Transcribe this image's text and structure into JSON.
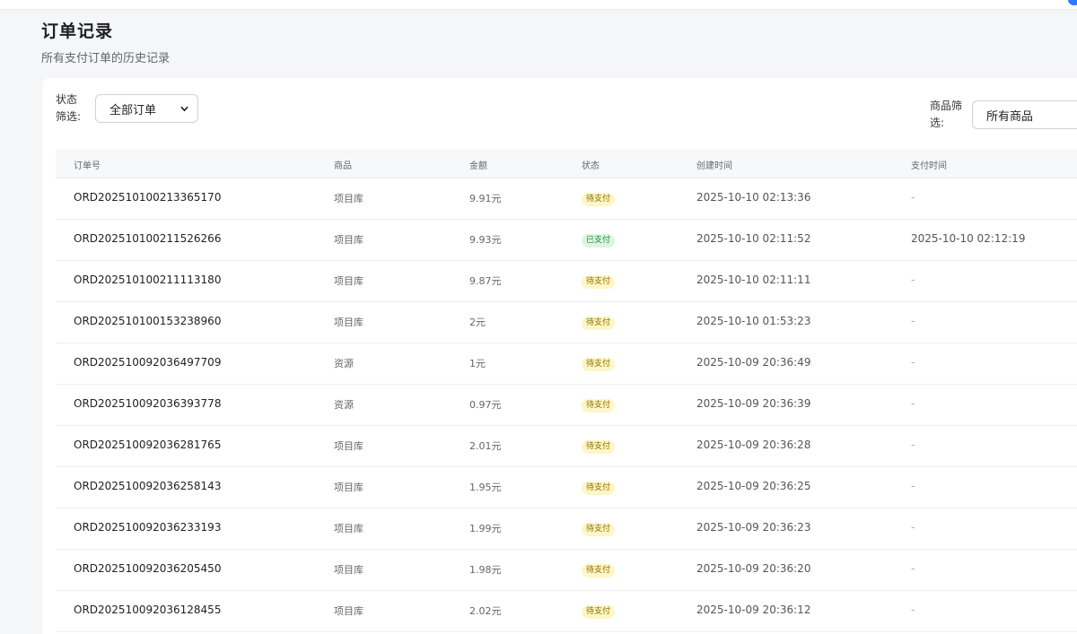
{
  "page": {
    "title": "订单记录",
    "subtitle": "所有支付订单的历史记录"
  },
  "filters": {
    "status_label": "状态筛选:",
    "status_value": "全部订单",
    "product_label": "商品筛选:",
    "product_value": "所有商品"
  },
  "table": {
    "headers": {
      "order_no": "订单号",
      "product": "商品",
      "amount": "金额",
      "status": "状态",
      "created": "创建时间",
      "paid": "支付时间"
    },
    "rows": [
      {
        "order_no": "ORD202510100213365170",
        "product": "项目库",
        "amount": "9.91元",
        "status": "待支付",
        "status_type": "pending",
        "created": "2025-10-10 02:13:36",
        "paid": "-"
      },
      {
        "order_no": "ORD202510100211526266",
        "product": "项目库",
        "amount": "9.93元",
        "status": "已支付",
        "status_type": "paid",
        "created": "2025-10-10 02:11:52",
        "paid": "2025-10-10 02:12:19"
      },
      {
        "order_no": "ORD202510100211113180",
        "product": "项目库",
        "amount": "9.87元",
        "status": "待支付",
        "status_type": "pending",
        "created": "2025-10-10 02:11:11",
        "paid": "-"
      },
      {
        "order_no": "ORD202510100153238960",
        "product": "项目库",
        "amount": "2元",
        "status": "待支付",
        "status_type": "pending",
        "created": "2025-10-10 01:53:23",
        "paid": "-"
      },
      {
        "order_no": "ORD202510092036497709",
        "product": "资源",
        "amount": "1元",
        "status": "待支付",
        "status_type": "pending",
        "created": "2025-10-09 20:36:49",
        "paid": "-"
      },
      {
        "order_no": "ORD202510092036393778",
        "product": "资源",
        "amount": "0.97元",
        "status": "待支付",
        "status_type": "pending",
        "created": "2025-10-09 20:36:39",
        "paid": "-"
      },
      {
        "order_no": "ORD202510092036281765",
        "product": "项目库",
        "amount": "2.01元",
        "status": "待支付",
        "status_type": "pending",
        "created": "2025-10-09 20:36:28",
        "paid": "-"
      },
      {
        "order_no": "ORD202510092036258143",
        "product": "项目库",
        "amount": "1.95元",
        "status": "待支付",
        "status_type": "pending",
        "created": "2025-10-09 20:36:25",
        "paid": "-"
      },
      {
        "order_no": "ORD202510092036233193",
        "product": "项目库",
        "amount": "1.99元",
        "status": "待支付",
        "status_type": "pending",
        "created": "2025-10-09 20:36:23",
        "paid": "-"
      },
      {
        "order_no": "ORD202510092036205450",
        "product": "项目库",
        "amount": "1.98元",
        "status": "待支付",
        "status_type": "pending",
        "created": "2025-10-09 20:36:20",
        "paid": "-"
      },
      {
        "order_no": "ORD202510092036128455",
        "product": "项目库",
        "amount": "2.02元",
        "status": "待支付",
        "status_type": "pending",
        "created": "2025-10-09 20:36:12",
        "paid": "-"
      }
    ]
  },
  "colors": {
    "pending_bg": "#fdf6c6",
    "paid_bg": "#dcf5e3",
    "accent": "#2f7cf6"
  }
}
